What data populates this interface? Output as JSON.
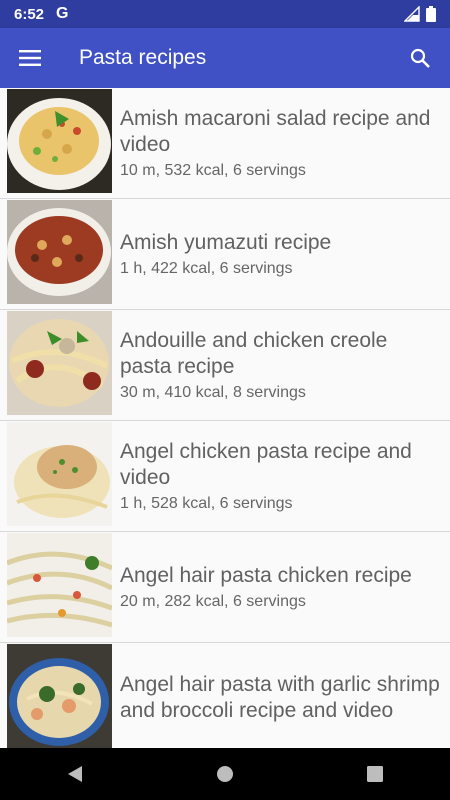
{
  "status": {
    "time": "6:52",
    "g_label": "G"
  },
  "appbar": {
    "title": "Pasta recipes",
    "menu_icon": "hamburger-icon",
    "search_icon": "search-icon"
  },
  "colors": {
    "status_bar": "#2f3da0",
    "app_bar": "#3f51c4",
    "title_text": "#616161"
  },
  "recipes": [
    {
      "title": "Amish macaroni salad recipe and video",
      "meta": "10 m, 532 kcal, 6 servings"
    },
    {
      "title": "Amish yumazuti recipe",
      "meta": "1 h, 422 kcal, 6 servings"
    },
    {
      "title": "Andouille and chicken creole pasta recipe",
      "meta": "30 m, 410 kcal, 8 servings"
    },
    {
      "title": "Angel chicken pasta recipe and video",
      "meta": "1 h, 528 kcal, 6 servings"
    },
    {
      "title": "Angel hair pasta chicken recipe",
      "meta": "20 m, 282 kcal, 6 servings"
    },
    {
      "title": "Angel hair pasta with garlic shrimp and broccoli recipe and video",
      "meta": ""
    }
  ],
  "navbar": {
    "back_icon": "back-icon",
    "home_icon": "home-icon",
    "recents_icon": "recents-icon"
  }
}
